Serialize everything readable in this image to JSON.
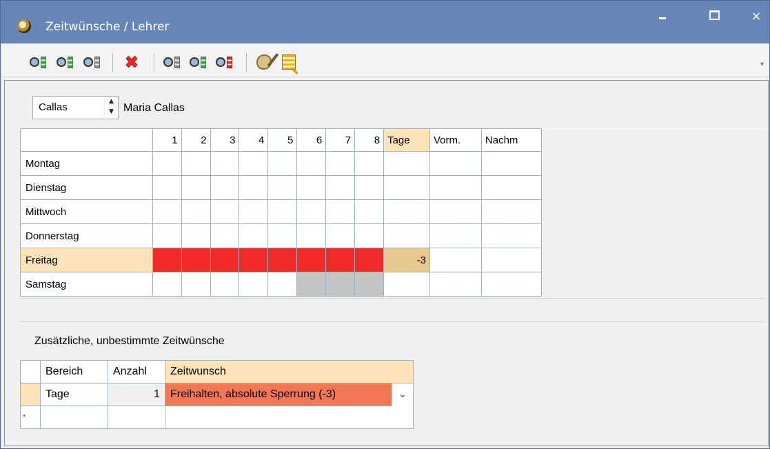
{
  "window": {
    "title": "Zeitwünsche / Lehrer",
    "controls": {
      "minimize": "‒",
      "maximize": "□",
      "close": "×"
    }
  },
  "toolbar": {
    "buttons": [
      {
        "name": "teacher-wish-button-1",
        "icon": "gear-green-tower"
      },
      {
        "name": "teacher-wish-button-2",
        "icon": "gear-green-tower"
      },
      {
        "name": "teacher-wish-button-3",
        "icon": "gear-gray-tower"
      },
      {
        "name": "delete-button",
        "icon": "red-x"
      },
      {
        "name": "period-wish-button-1",
        "icon": "gear-gray-tower"
      },
      {
        "name": "period-wish-button-2",
        "icon": "gear-green-tower"
      },
      {
        "name": "period-wish-button-3",
        "icon": "gear-red-tower"
      },
      {
        "name": "palette-button",
        "icon": "palette"
      },
      {
        "name": "report-button",
        "icon": "list"
      }
    ],
    "dropdown": "▾"
  },
  "teacher": {
    "short_name": "Callas",
    "full_name": "Maria Callas"
  },
  "grid": {
    "headers": [
      "1",
      "2",
      "3",
      "4",
      "5",
      "6",
      "7",
      "8",
      "Tage",
      "Vorm.",
      "Nachm"
    ],
    "rows": [
      {
        "day": "Montag",
        "cells": [
          "",
          "",
          "",
          "",
          "",
          "",
          "",
          ""
        ],
        "tage": "",
        "vorm": "",
        "nachm": ""
      },
      {
        "day": "Dienstag",
        "cells": [
          "",
          "",
          "",
          "",
          "",
          "",
          "",
          ""
        ],
        "tage": "",
        "vorm": "",
        "nachm": ""
      },
      {
        "day": "Mittwoch",
        "cells": [
          "",
          "",
          "",
          "",
          "",
          "",
          "",
          ""
        ],
        "tage": "",
        "vorm": "",
        "nachm": ""
      },
      {
        "day": "Donnerstag",
        "cells": [
          "",
          "",
          "",
          "",
          "",
          "",
          "",
          ""
        ],
        "tage": "",
        "vorm": "",
        "nachm": ""
      },
      {
        "day": "Freitag",
        "cells": [
          "",
          "",
          "",
          "",
          "",
          "",
          "",
          ""
        ],
        "tage": "-3",
        "vorm": "",
        "nachm": ""
      },
      {
        "day": "Samstag",
        "cells": [
          "",
          "",
          "",
          "",
          "",
          "",
          "",
          ""
        ],
        "tage": "",
        "vorm": "",
        "nachm": ""
      }
    ],
    "colors": {
      "red": "#f12b2b",
      "gray": "#c4c4c4",
      "highlight": "#fde3b7"
    }
  },
  "additional": {
    "label": "Zusätzliche, unbestimmte Zeitwünsche",
    "columns": [
      "Bereich",
      "Anzahl",
      "Zeitwunsch"
    ],
    "row": {
      "bereich": "Tage",
      "anzahl": "1",
      "zeitwunsch": "Freihalten, absolute Sperrung (-3)"
    },
    "new_row_marker": "*"
  }
}
